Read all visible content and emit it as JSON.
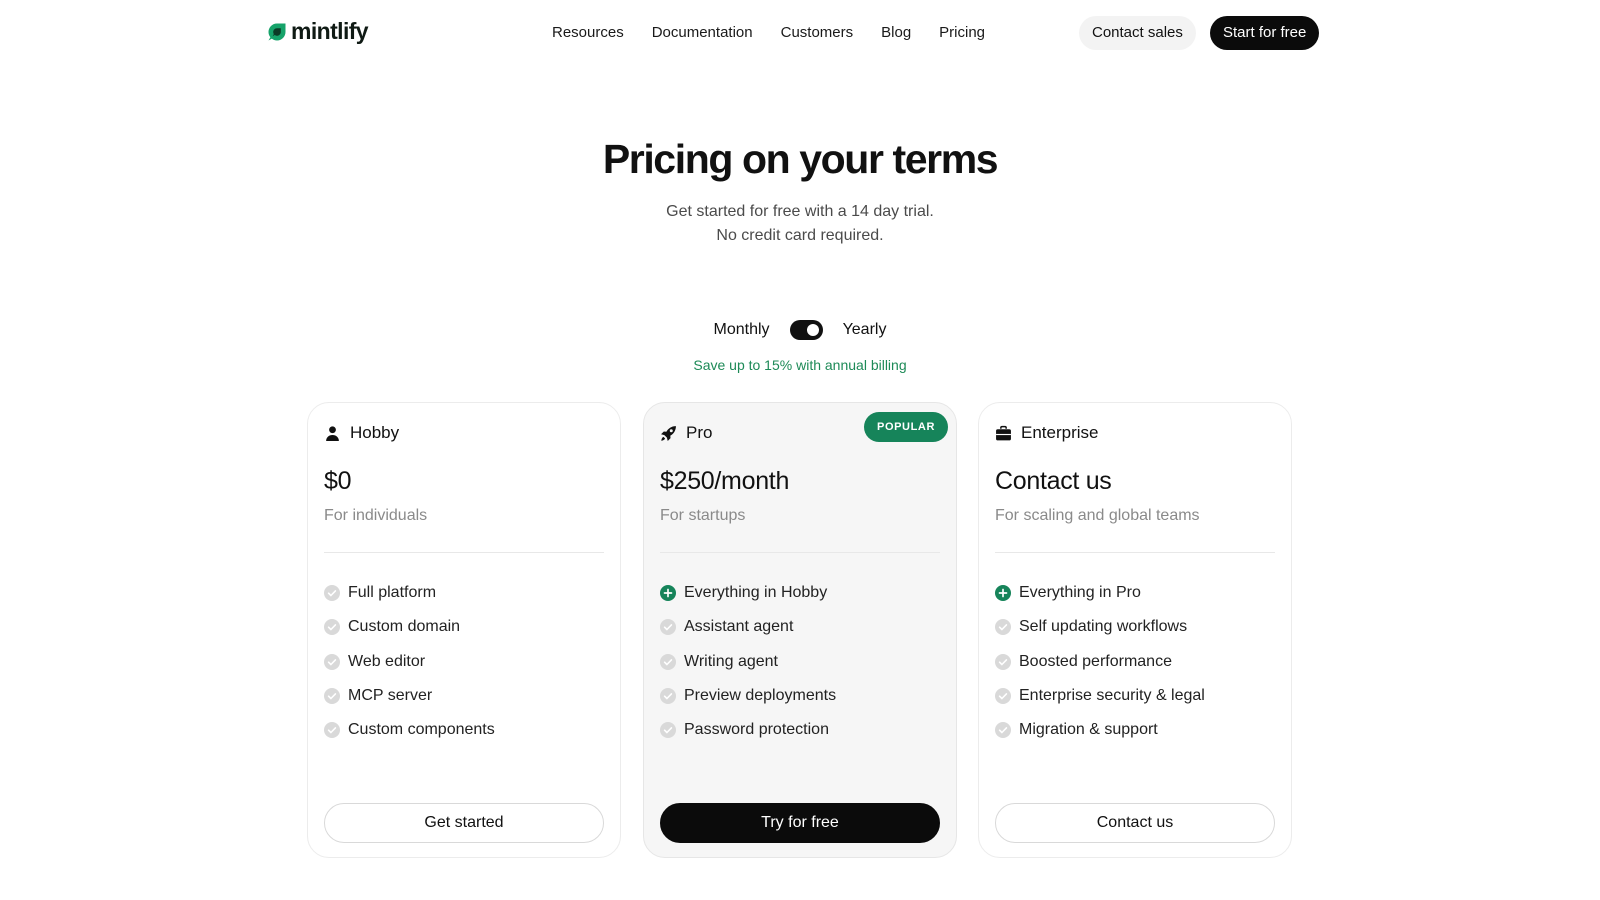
{
  "header": {
    "logo_text": "mintlify",
    "nav": [
      "Resources",
      "Documentation",
      "Customers",
      "Blog",
      "Pricing"
    ],
    "contact_sales": "Contact sales",
    "start_free": "Start for free"
  },
  "hero": {
    "title": "Pricing on your terms",
    "subtitle_line1": "Get started for free with a 14 day trial.",
    "subtitle_line2": "No credit card required."
  },
  "billing": {
    "monthly": "Monthly",
    "yearly": "Yearly",
    "selected": "Yearly",
    "note": "Save up to 15% with annual billing"
  },
  "colors": {
    "accent_green": "#16845a",
    "primary_black": "#0b0b0b"
  },
  "plans": [
    {
      "name": "Hobby",
      "icon": "user-icon",
      "price": "$0",
      "description": "For individuals",
      "badge": "",
      "features": [
        {
          "text": "Full platform",
          "icon": "check-circle-icon"
        },
        {
          "text": "Custom domain",
          "icon": "check-circle-icon"
        },
        {
          "text": "Web editor",
          "icon": "check-circle-icon"
        },
        {
          "text": "MCP server",
          "icon": "check-circle-icon"
        },
        {
          "text": "Custom components",
          "icon": "check-circle-icon"
        }
      ],
      "cta": "Get started"
    },
    {
      "name": "Pro",
      "icon": "rocket-icon",
      "price": "$250/month",
      "description": "For startups",
      "badge": "POPULAR",
      "features": [
        {
          "text": "Everything in Hobby",
          "icon": "plus-circle-icon"
        },
        {
          "text": "Assistant agent",
          "icon": "check-circle-icon"
        },
        {
          "text": "Writing agent",
          "icon": "check-circle-icon"
        },
        {
          "text": "Preview deployments",
          "icon": "check-circle-icon"
        },
        {
          "text": "Password protection",
          "icon": "check-circle-icon"
        }
      ],
      "cta": "Try for free"
    },
    {
      "name": "Enterprise",
      "icon": "briefcase-icon",
      "price": "Contact us",
      "description": "For scaling and global teams",
      "badge": "",
      "features": [
        {
          "text": "Everything in Pro",
          "icon": "plus-circle-icon"
        },
        {
          "text": "Self updating workflows",
          "icon": "check-circle-icon"
        },
        {
          "text": "Boosted performance",
          "icon": "check-circle-icon"
        },
        {
          "text": "Enterprise security & legal",
          "icon": "check-circle-icon"
        },
        {
          "text": "Migration & support",
          "icon": "check-circle-icon"
        }
      ],
      "cta": "Contact us"
    }
  ]
}
